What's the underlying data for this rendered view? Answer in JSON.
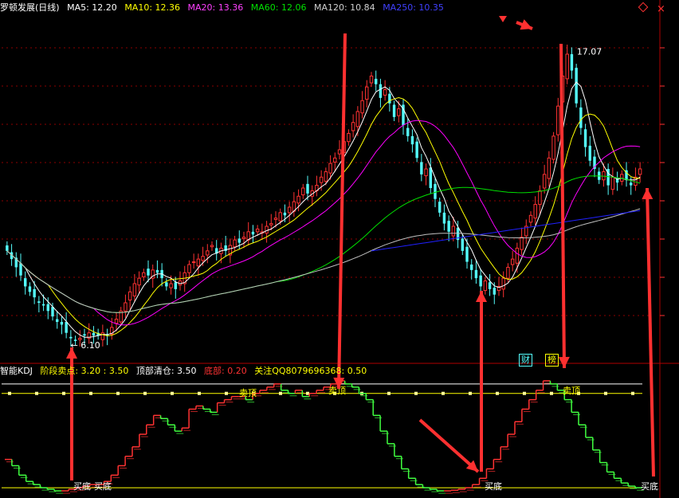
{
  "colors": {
    "bg": "#000000",
    "up": "#ff3232",
    "down": "#54fcfc",
    "ma5": "#ffffff",
    "ma10": "#ffff00",
    "ma20": "#ff00ff",
    "ma60": "#00e000",
    "ma120": "#c0c0c0",
    "ma250": "#2020ff",
    "grid": "#8b0000"
  },
  "header": {
    "title": "罗顿发展(日线)",
    "ma5": "MA5: 12.20",
    "ma10": "MA10: 12.36",
    "ma20": "MA20: 13.36",
    "ma60": "MA60: 12.06",
    "ma120": "MA120: 10.84",
    "ma250": "MA250: 10.35"
  },
  "kdj_header": {
    "name": "智能KDJ",
    "stage_sell": "阶段卖点: 3.20 : 3.50",
    "top_clear": "顶部清仓: 3.50",
    "bottom": "底部: 0.20",
    "contact": "关注QQ8079696368: 0.50"
  },
  "tags": {
    "finance": "财",
    "rank": "榜"
  },
  "annotations": {
    "high": "17.07",
    "low": "← 6.10",
    "sell": "卖顶",
    "buy": "买底"
  },
  "icons": [
    "close-icon",
    "diamond-icon",
    "arrow-down-icon"
  ],
  "chart_data": [
    {
      "type": "candlestick",
      "title": "罗顿发展(日线)",
      "ylim": [
        5.6,
        18.2
      ],
      "y_ticks": [],
      "high_label": 17.07,
      "low_label": 6.1,
      "moving_averages": {
        "MA5": 12.2,
        "MA10": 12.36,
        "MA20": 13.36,
        "MA60": 12.06,
        "MA120": 10.84,
        "MA250": 10.35
      },
      "close_series": [
        9.6,
        9.3,
        9.0,
        8.7,
        8.3,
        8.1,
        7.9,
        7.7,
        7.6,
        7.4,
        7.2,
        7.0,
        6.9,
        6.6,
        6.4,
        6.3,
        6.4,
        6.5,
        6.6,
        6.5,
        6.5,
        6.6,
        6.5,
        6.8,
        7.1,
        7.4,
        7.7,
        8.1,
        8.4,
        8.6,
        8.8,
        8.7,
        8.9,
        8.8,
        8.6,
        8.3,
        8.4,
        8.2,
        8.5,
        8.8,
        9.1,
        9.2,
        9.3,
        9.4,
        9.6,
        9.8,
        9.5,
        9.7,
        9.6,
        9.8,
        10.0,
        9.9,
        10.1,
        10.3,
        10.2,
        10.4,
        10.3,
        10.5,
        10.6,
        10.8,
        11.0,
        10.9,
        11.2,
        11.4,
        11.6,
        11.9,
        11.7,
        11.8,
        12.0,
        12.3,
        12.5,
        12.8,
        13.0,
        13.3,
        13.6,
        13.9,
        14.3,
        14.7,
        15.1,
        15.6,
        16.0,
        15.7,
        15.2,
        15.5,
        15.0,
        14.5,
        14.8,
        14.2,
        13.8,
        13.5,
        13.0,
        12.4,
        12.6,
        11.9,
        11.5,
        11.0,
        10.6,
        10.3,
        10.5,
        10.0,
        9.6,
        9.2,
        8.9,
        8.6,
        8.3,
        8.5,
        8.2,
        8.0,
        8.3,
        8.6,
        9.0,
        9.3,
        9.7,
        10.1,
        10.5,
        10.9,
        11.3,
        11.8,
        12.4,
        13.0,
        13.8,
        14.9,
        16.0,
        16.8,
        16.2,
        15.0,
        14.1,
        13.4,
        12.9,
        12.6,
        12.2,
        12.5,
        12.0,
        12.3,
        12.1,
        12.4,
        12.2,
        12.0,
        12.3,
        12.6
      ]
    },
    {
      "type": "line",
      "title": "智能KDJ",
      "ylim": [
        0,
        3.7
      ],
      "series": [
        {
          "name": "KDJ",
          "values": [
            1.1,
            0.9,
            0.6,
            0.4,
            0.3,
            0.2,
            0.15,
            0.1,
            0.1,
            0.15,
            0.2,
            0.25,
            0.3,
            0.3,
            0.4,
            0.6,
            0.9,
            1.2,
            1.5,
            1.9,
            2.2,
            2.5,
            2.4,
            2.2,
            2.0,
            2.1,
            2.7,
            2.8,
            2.7,
            2.6,
            2.9,
            3.0,
            3.1,
            3.1,
            3.0,
            3.2,
            3.3,
            3.4,
            3.5,
            3.3,
            3.2,
            3.3,
            3.1,
            3.2,
            3.3,
            3.4,
            3.5,
            3.6,
            3.5,
            3.4,
            3.2,
            3.0,
            2.5,
            2.0,
            1.6,
            1.2,
            0.8,
            0.5,
            0.3,
            0.2,
            0.15,
            0.1,
            0.1,
            0.12,
            0.15,
            0.2,
            0.3,
            0.5,
            0.8,
            1.1,
            1.5,
            1.9,
            2.3,
            2.7,
            3.0,
            3.3,
            3.6,
            3.5,
            3.3,
            3.0,
            2.6,
            2.2,
            1.8,
            1.4,
            1.0,
            0.7,
            0.5,
            0.35,
            0.25,
            0.2
          ]
        }
      ],
      "sell_threshold": 3.5,
      "stage_sell": [
        3.2,
        3.5
      ],
      "bottom_line": 0.2
    }
  ]
}
